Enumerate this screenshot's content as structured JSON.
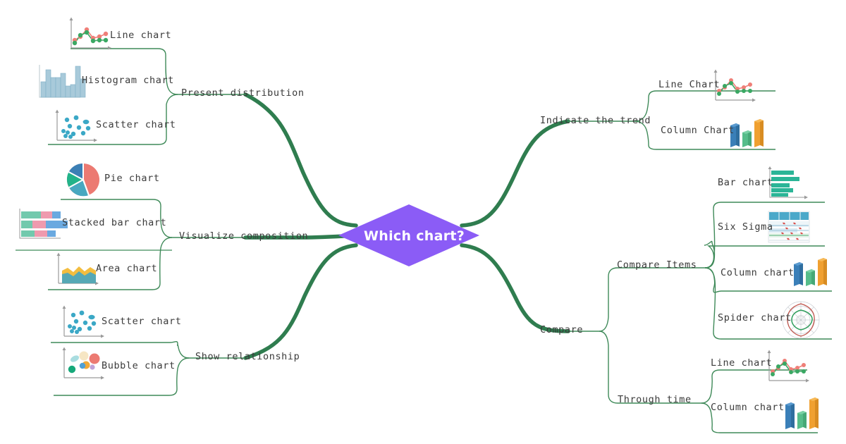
{
  "diagram": {
    "title": "Which chart?",
    "center": {
      "label": "Which chart?",
      "fill": "#8b5cf6",
      "text_color": "#ffffff",
      "shape": "diamond"
    },
    "branch_color": "#2f7d4f",
    "label_color": "#3b3b3b"
  },
  "left_branches": [
    {
      "label": "Present distribution",
      "children": [
        {
          "label": "Line chart",
          "icon": "line-chart-icon"
        },
        {
          "label": "Histogram chart",
          "icon": "histogram-chart-icon"
        },
        {
          "label": "Scatter chart",
          "icon": "scatter-chart-icon"
        }
      ]
    },
    {
      "label": "Visualize composition",
      "children": [
        {
          "label": "Pie chart",
          "icon": "pie-chart-icon"
        },
        {
          "label": "Stacked bar chart",
          "icon": "stacked-bar-chart-icon"
        },
        {
          "label": "Area chart",
          "icon": "area-chart-icon"
        }
      ]
    },
    {
      "label": "Show relationship",
      "children": [
        {
          "label": "Scatter chart",
          "icon": "scatter-chart-icon"
        },
        {
          "label": "Bubble chart",
          "icon": "bubble-chart-icon"
        }
      ]
    }
  ],
  "right_branches": [
    {
      "label": "Indicate the trend",
      "children": [
        {
          "label": "Line Chart",
          "icon": "line-chart-icon"
        },
        {
          "label": "Column Chart",
          "icon": "column-chart-icon"
        }
      ]
    },
    {
      "label": "Compare",
      "subgroups": [
        {
          "label": "Compare Items",
          "children": [
            {
              "label": "Bar chart",
              "icon": "bar-chart-icon"
            },
            {
              "label": "Six Sigma",
              "icon": "six-sigma-icon"
            },
            {
              "label": "Column chart",
              "icon": "column-chart-icon"
            },
            {
              "label": "Spider chart",
              "icon": "spider-chart-icon"
            }
          ]
        },
        {
          "label": "Through time",
          "children": [
            {
              "label": "Line chart",
              "icon": "line-chart-icon"
            },
            {
              "label": "Column chart",
              "icon": "column-chart-icon"
            }
          ]
        }
      ]
    }
  ],
  "palette": {
    "green_line": "#2f7d4f",
    "thin_line": "#4a8f63",
    "steel_blue": "#9ec6da",
    "teal_dot": "#3ba8c6",
    "salmon": "#ec7a72",
    "pie_blue": "#3b7fb5",
    "pie_green": "#22b38a",
    "pie_teal": "#48a8c0",
    "stack_green": "#72c9ad",
    "stack_pink": "#ef9aae",
    "stack_blue": "#6aa9e0",
    "area_teal": "#56a8b5",
    "area_yellow": "#f3bd3f",
    "bar_teal": "#2bb597",
    "col_blue": "#3a7fb8",
    "col_green": "#56bd8a",
    "col_orange": "#f0a030",
    "spider_red": "#c0554c",
    "spider_green": "#2f9e5c",
    "line_green": "#3aa863",
    "line_red": "#ef7f78"
  }
}
